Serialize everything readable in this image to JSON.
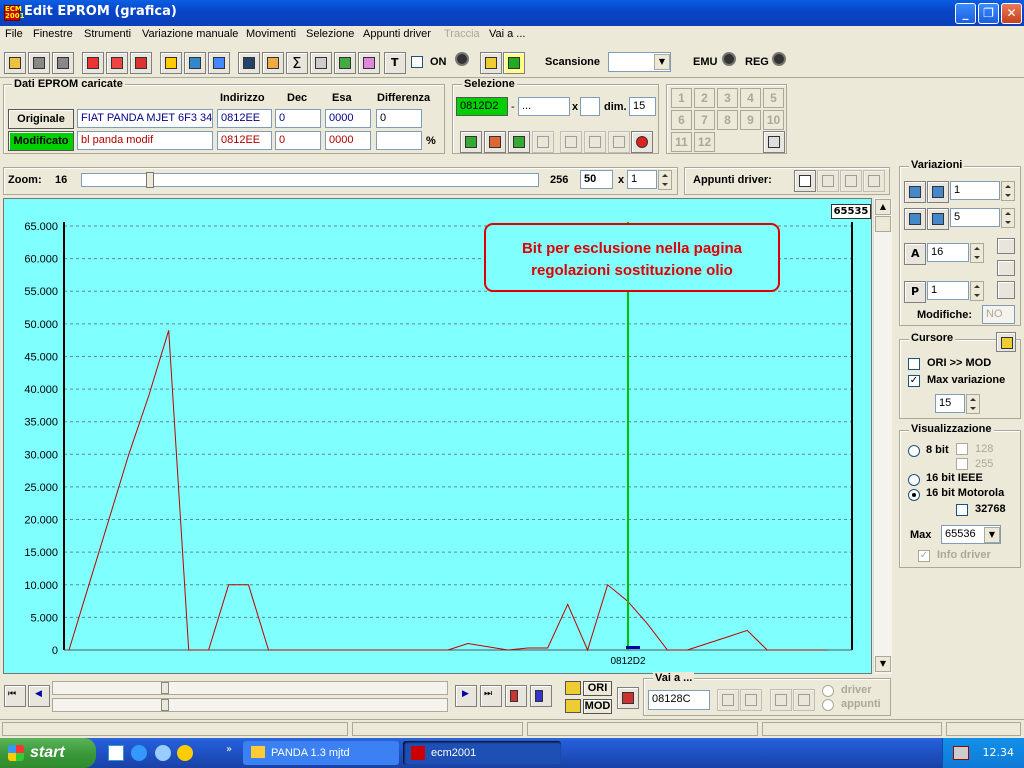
{
  "window": {
    "title": "Edit EPROM (grafica)"
  },
  "menu": [
    "File",
    "Finestre",
    "Strumenti",
    "Variazione manuale",
    "Movimenti",
    "Selezione",
    "Appunti driver",
    "Traccia",
    "Vai a ..."
  ],
  "toolbar": {
    "on_label": "ON",
    "scansione_label": "Scansione",
    "scansione_value": "",
    "emu_label": "EMU",
    "reg_label": "REG"
  },
  "dati": {
    "title": "Dati EPROM caricate",
    "headers": {
      "indirizzo": "Indirizzo",
      "dec": "Dec",
      "esa": "Esa",
      "differenza": "Differenza"
    },
    "originale": {
      "label": "Originale",
      "name": "FIAT PANDA MJET 6F3 34",
      "indirizzo": "0812EE",
      "dec": "0",
      "esa": "0000",
      "differenza": "0"
    },
    "modificato": {
      "label": "Modificato",
      "name": "bl panda modif",
      "indirizzo": "0812EE",
      "dec": "0",
      "esa": "0000",
      "differenza": ""
    },
    "percent": "%"
  },
  "selezione": {
    "title": "Selezione",
    "start": "0812D2",
    "dash": "-",
    "end": "...",
    "x": "x",
    "dim_label": "dim.",
    "dim_value": "15"
  },
  "number_buttons": [
    "1",
    "2",
    "3",
    "4",
    "5",
    "6",
    "7",
    "8",
    "9",
    "10",
    "11",
    "12"
  ],
  "zoom": {
    "label": "Zoom:",
    "min": "16",
    "max": "256",
    "value": "50",
    "x": "x",
    "mult": "1"
  },
  "appunti": {
    "label": "Appunti driver:"
  },
  "variazioni": {
    "title": "Variazioni",
    "v1": "1",
    "v2": "5",
    "v3": "16",
    "v4": "1",
    "modifiche_label": "Modifiche:",
    "modifiche_value": "NO"
  },
  "cursore": {
    "title": "Cursore",
    "ori_mod": "ORI >> MOD",
    "max_variazione": "Max variazione",
    "max_value": "15"
  },
  "visualizzazione": {
    "title": "Visualizzazione",
    "bit8": "8 bit",
    "v128": "128",
    "v255": "255",
    "ieee": "16 bit IEEE",
    "motorola": "16 bit Motorola",
    "v32768": "32768",
    "max_label": "Max",
    "max_value": "65536",
    "info_driver": "Info driver"
  },
  "bottom": {
    "ori": "ORI",
    "mod": "MOD",
    "vai_title": "Vai a ...",
    "vai_value": "08128C",
    "driver": "driver",
    "appunti": "appunti"
  },
  "taskbar": {
    "start": "start",
    "task1": "PANDA 1.3 mjtd",
    "task2": "ecm2001",
    "clock": "12.34"
  },
  "chart_data": {
    "type": "line",
    "ymax_label": "65535",
    "ylim": [
      0,
      65535
    ],
    "yticks": [
      "0",
      "5.000",
      "10.000",
      "15.000",
      "20.000",
      "25.000",
      "30.000",
      "35.000",
      "40.000",
      "45.000",
      "50.000",
      "55.000",
      "60.000",
      "65.000"
    ],
    "cursor_label": "0812D2",
    "annotation": "Bit per esclusione nella pagina regolazioni sostituzione olio",
    "series": [
      {
        "values": [
          0,
          10000,
          20000,
          30000,
          39000,
          49000,
          0,
          0,
          10000,
          10000,
          0,
          0,
          0,
          0,
          0,
          0,
          0,
          0,
          0,
          0,
          1000,
          500,
          0,
          300,
          300,
          7000,
          0,
          10000,
          7500,
          4000,
          0,
          0,
          1000,
          2000,
          3000,
          0,
          0,
          0,
          0
        ]
      }
    ],
    "colors": {
      "line": "#c00000",
      "cursor": "#00c000",
      "bg": "#80ffff"
    }
  }
}
